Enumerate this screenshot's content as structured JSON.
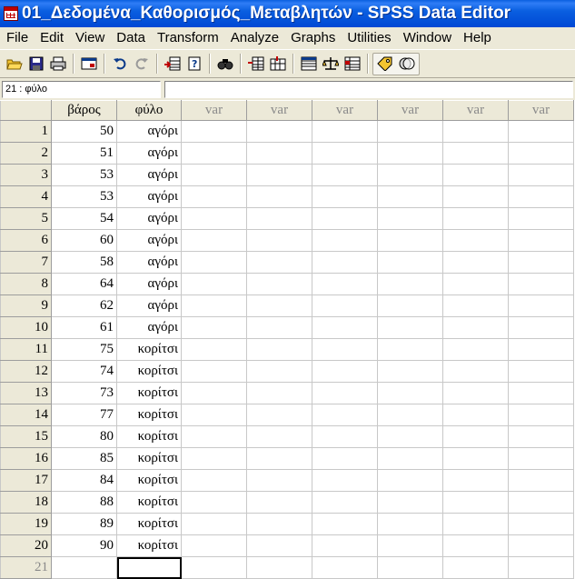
{
  "window": {
    "title": "01_Δεδομένα_Καθορισμός_Μεταβλητών - SPSS Data Editor"
  },
  "menu": [
    "File",
    "Edit",
    "View",
    "Data",
    "Transform",
    "Analyze",
    "Graphs",
    "Utilities",
    "Window",
    "Help"
  ],
  "toolbar": {
    "buttons": [
      "open-icon",
      "save-icon",
      "print-icon",
      "dialog-recall-icon",
      "undo-icon",
      "redo-icon",
      "goto-case-icon",
      "variables-icon",
      "find-icon",
      "insert-case-icon",
      "insert-variable-icon",
      "split-file-icon",
      "weight-cases-icon",
      "select-cases-icon",
      "value-labels-icon",
      "use-sets-icon"
    ]
  },
  "cell_editor": {
    "reference": "21 : φύλο",
    "value": ""
  },
  "columns": [
    "βάρος",
    "φύλο",
    "var",
    "var",
    "var",
    "var",
    "var",
    "var"
  ],
  "rows": [
    {
      "n": "1",
      "weight": "50",
      "gender": "αγόρι"
    },
    {
      "n": "2",
      "weight": "51",
      "gender": "αγόρι"
    },
    {
      "n": "3",
      "weight": "53",
      "gender": "αγόρι"
    },
    {
      "n": "4",
      "weight": "53",
      "gender": "αγόρι"
    },
    {
      "n": "5",
      "weight": "54",
      "gender": "αγόρι"
    },
    {
      "n": "6",
      "weight": "60",
      "gender": "αγόρι"
    },
    {
      "n": "7",
      "weight": "58",
      "gender": "αγόρι"
    },
    {
      "n": "8",
      "weight": "64",
      "gender": "αγόρι"
    },
    {
      "n": "9",
      "weight": "62",
      "gender": "αγόρι"
    },
    {
      "n": "10",
      "weight": "61",
      "gender": "αγόρι"
    },
    {
      "n": "11",
      "weight": "75",
      "gender": "κορίτσι"
    },
    {
      "n": "12",
      "weight": "74",
      "gender": "κορίτσι"
    },
    {
      "n": "13",
      "weight": "73",
      "gender": "κορίτσι"
    },
    {
      "n": "14",
      "weight": "77",
      "gender": "κορίτσι"
    },
    {
      "n": "15",
      "weight": "80",
      "gender": "κορίτσι"
    },
    {
      "n": "16",
      "weight": "85",
      "gender": "κορίτσι"
    },
    {
      "n": "17",
      "weight": "84",
      "gender": "κορίτσι"
    },
    {
      "n": "18",
      "weight": "88",
      "gender": "κορίτσι"
    },
    {
      "n": "19",
      "weight": "89",
      "gender": "κορίτσι"
    },
    {
      "n": "20",
      "weight": "90",
      "gender": "κορίτσι"
    },
    {
      "n": "21",
      "weight": "",
      "gender": ""
    }
  ],
  "active_cell": {
    "row": "21",
    "column": "φύλο"
  }
}
